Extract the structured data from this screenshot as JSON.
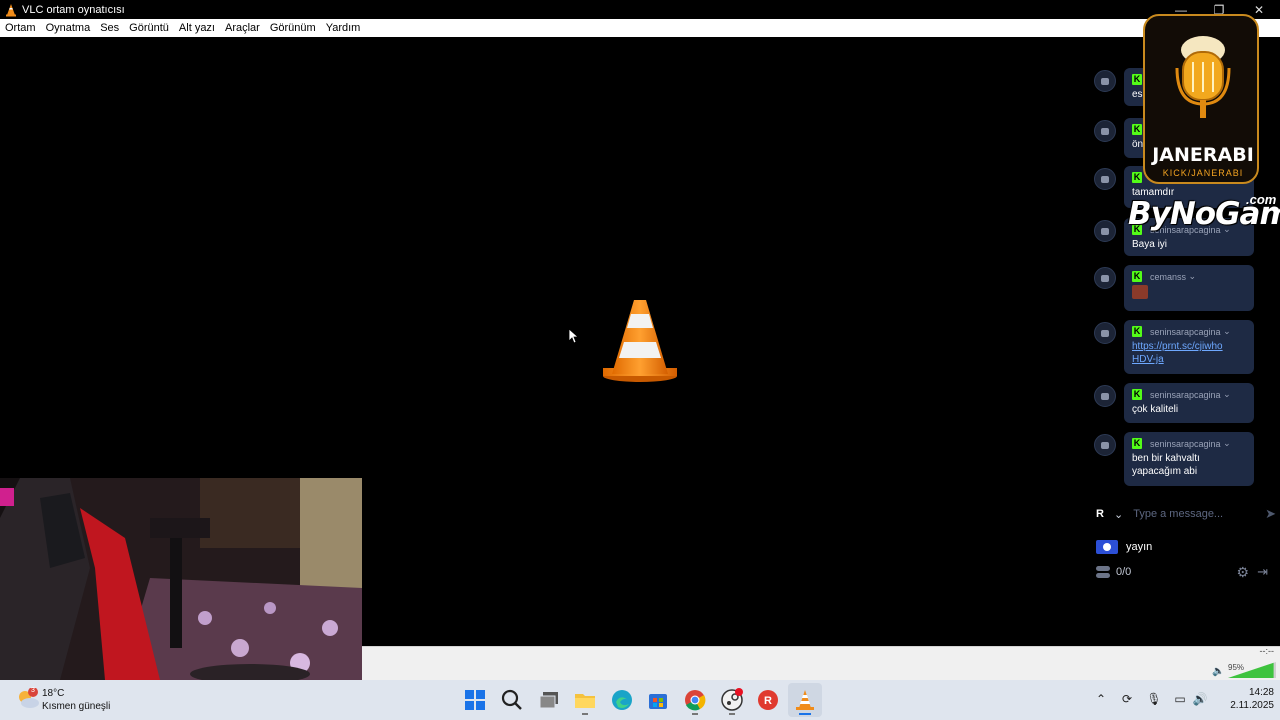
{
  "window": {
    "title": "VLC ortam oynatıcısı",
    "minimize_glyph": "—",
    "restore_glyph": "❐",
    "close_glyph": "✕"
  },
  "menu": [
    "Ortam",
    "Oynatma",
    "Ses",
    "Görüntü",
    "Alt yazı",
    "Araçlar",
    "Görünüm",
    "Yardım"
  ],
  "chat": {
    "messages": [
      {
        "user": "",
        "text": "es"
      },
      {
        "user": "",
        "text": "ön"
      },
      {
        "user": "",
        "text": "tamamdır"
      },
      {
        "user": "seninsarapcagina",
        "text": "Baya iyi"
      },
      {
        "user": "cemanss",
        "text": "",
        "emote": true
      },
      {
        "user": "seninsarapcagina",
        "link": "https://prnt.sc/cjiwho HDV-ja"
      },
      {
        "user": "seninsarapcagina",
        "text": "çok kaliteli"
      },
      {
        "user": "seninsarapcagina",
        "text": "ben bir kahvaltı yapacağım abi"
      }
    ],
    "chevron": "⌄",
    "input_badge": "R",
    "input_placeholder": "Type a message...",
    "send_glyph": "➤",
    "pinned_label": "yayın",
    "counter": "0/0"
  },
  "overlay": {
    "logo_name": "JANERABI",
    "logo_sub": "KICK/JANERABI",
    "watermark": "ByNoGame",
    "watermark_com": ".com"
  },
  "player": {
    "time": "--:--",
    "volume": "95%",
    "volume_level": 0.95
  },
  "taskbar": {
    "weather_temp": "18°C",
    "weather_cond": "Kısmen güneşli",
    "weather_badge": "3",
    "time": "14:28",
    "date": "2.11.2025",
    "icons": [
      "start-icon",
      "search-icon",
      "task-view-icon",
      "file-explorer-icon",
      "edge-icon",
      "store-icon",
      "chrome-icon",
      "steam-icon",
      "rockstar-icon",
      "vlc-icon"
    ]
  },
  "colors": {
    "chat_bubble": "#1e2a44",
    "kick_green": "#53fc18",
    "vlc_orange": "#f08c1a",
    "logo_gold": "#c98a1e"
  }
}
